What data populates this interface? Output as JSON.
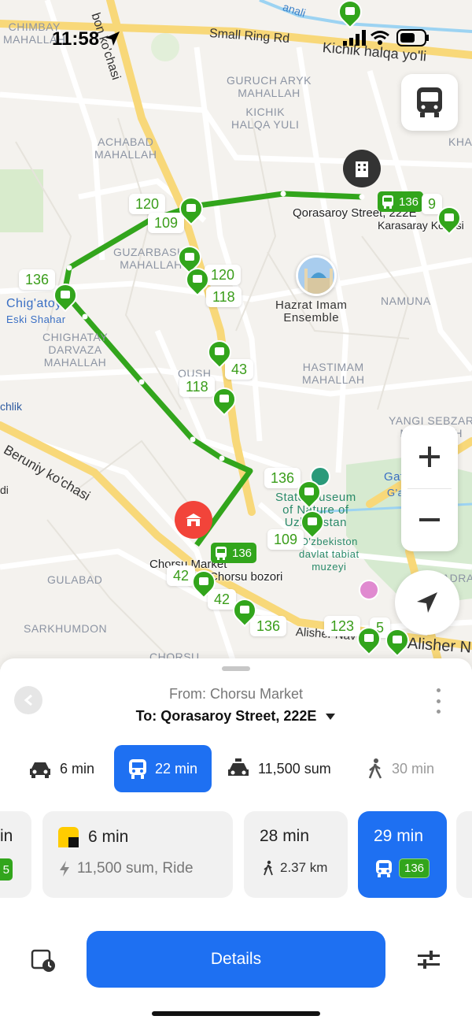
{
  "status_bar": {
    "time": "11:58"
  },
  "map": {
    "district_labels": [
      {
        "id": "chimbay",
        "text": "CHIMBAY\nMAHALLAH"
      },
      {
        "id": "guruch",
        "text": "GURUCH ARYK\nMAHALLAH"
      },
      {
        "id": "kichik",
        "text": "KICHIK\nHALQA YULI"
      },
      {
        "id": "achabad",
        "text": "ACHABAD\nMAHALLAH"
      },
      {
        "id": "guzarbashi",
        "text": "GUZARBASHI\nMAHALLAH"
      },
      {
        "id": "namuna",
        "text": "NAMUNA"
      },
      {
        "id": "chighatay",
        "text": "CHIGHATAY\nDARVAZA\nMAHALLAH"
      },
      {
        "id": "hastimam",
        "text": "HASTIMAM\nMAHALLAH"
      },
      {
        "id": "yangi",
        "text": "YANGI SEBZAR\nMAHALLAH"
      },
      {
        "id": "gulabad",
        "text": "GULABAD"
      },
      {
        "id": "sarkhumdon",
        "text": "SARKHUMDON"
      },
      {
        "id": "chorsu",
        "text": "CHORSU"
      },
      {
        "id": "qush",
        "text": "QUSH"
      },
      {
        "id": "kha",
        "text": "KHA"
      },
      {
        "id": "xadra",
        "text": "XADRA"
      }
    ],
    "streets": {
      "small_ring": "Small Ring Rd",
      "kichik_halqa": "Kichik halqa yo'li",
      "beruniy": "Beruniy ko'chasi",
      "bon": "bon ko'chasi",
      "alisher_nav": "Alisher Nav",
      "alisher_n": "Alisher N",
      "anali": "anali",
      "chlik": "chlik",
      "di": "di"
    },
    "places": {
      "hazrat_imam": "Hazrat Imam\nEnsemble",
      "chigatoy": "Chig'atoy",
      "eski_shahar": "Eski Shahar",
      "state_museum": "State Museum\nof Nature of\nUzbekistan",
      "museum_uz": "O'zbekiston\ndavlat tabiat\nmuzeyi",
      "gafur_gulom": "Gafur Gulom",
      "gafur_gulom_uz": "G'afur G'ulom",
      "qorasaroy": "Qorasaroy Street, 222E",
      "karasaray": "Karasaray Koçesi",
      "chorsu_market": "Chorsu Market",
      "chorsu_bozori": "Chorsu bozori"
    },
    "route_numbers": {
      "r120a": "120",
      "r109a": "109",
      "r136a": "136",
      "r120b": "120",
      "r118a": "118",
      "r43": "43",
      "r118b": "118",
      "r136b": "136",
      "r109b": "109",
      "r42a": "42",
      "r42b": "42",
      "r136c": "136",
      "r123": "123",
      "r5": "5",
      "r9": "9"
    },
    "route_chips": {
      "top": "136",
      "chorsu": "136"
    },
    "route_color": "#32a51c"
  },
  "sheet": {
    "from": "From: Chorsu Market",
    "to": "To: Qorasaroy Street, 222E",
    "modes": [
      {
        "id": "car",
        "label": "6 min"
      },
      {
        "id": "transit",
        "label": "22 min"
      },
      {
        "id": "taxi",
        "label": "11,500 sum"
      },
      {
        "id": "walk",
        "label": "30 min"
      }
    ],
    "cards": {
      "partial_left": {
        "title": "in",
        "badge": "5"
      },
      "taxi": {
        "title": "6 min",
        "sub": "11,500 sum, Ride"
      },
      "walk": {
        "title": "28 min",
        "sub": "2.37 km"
      },
      "bus": {
        "title": "29 min",
        "badge": "136"
      }
    },
    "details_label": "Details"
  }
}
